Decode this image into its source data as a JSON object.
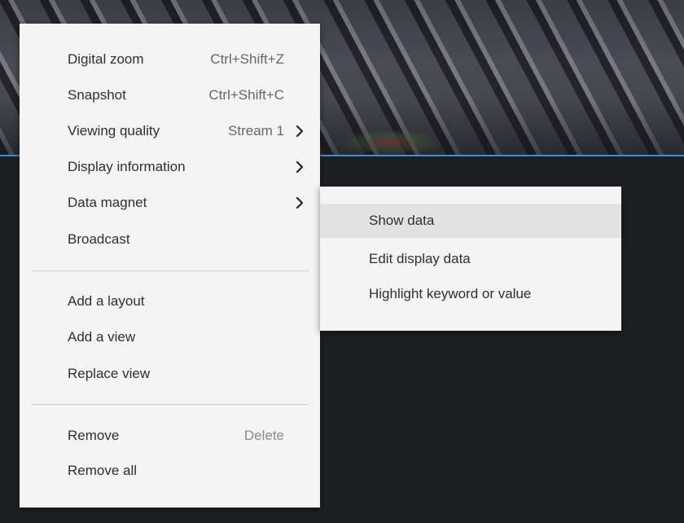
{
  "menu": {
    "items": [
      {
        "label": "Digital zoom",
        "shortcut": "Ctrl+Shift+Z"
      },
      {
        "label": "Snapshot",
        "shortcut": "Ctrl+Shift+C"
      },
      {
        "label": "Viewing quality",
        "shortcut": "Stream 1"
      },
      {
        "label": "Display information",
        "shortcut": ""
      },
      {
        "label": "Data magnet",
        "shortcut": ""
      },
      {
        "label": "Broadcast",
        "shortcut": ""
      },
      {
        "label": "Add a layout",
        "shortcut": ""
      },
      {
        "label": "Add a view",
        "shortcut": ""
      },
      {
        "label": "Replace view",
        "shortcut": ""
      },
      {
        "label": "Remove",
        "shortcut": "Delete"
      },
      {
        "label": "Remove all",
        "shortcut": ""
      }
    ]
  },
  "submenu": {
    "items": [
      {
        "label": "Show data"
      },
      {
        "label": "Edit display data"
      },
      {
        "label": "Highlight keyword or value"
      }
    ]
  },
  "colors": {
    "accent_line": "#3b8fd6",
    "menu_bg": "#f4f4f4",
    "highlight_bg": "#e2e2e2",
    "dark_bg": "#1d1f23"
  }
}
